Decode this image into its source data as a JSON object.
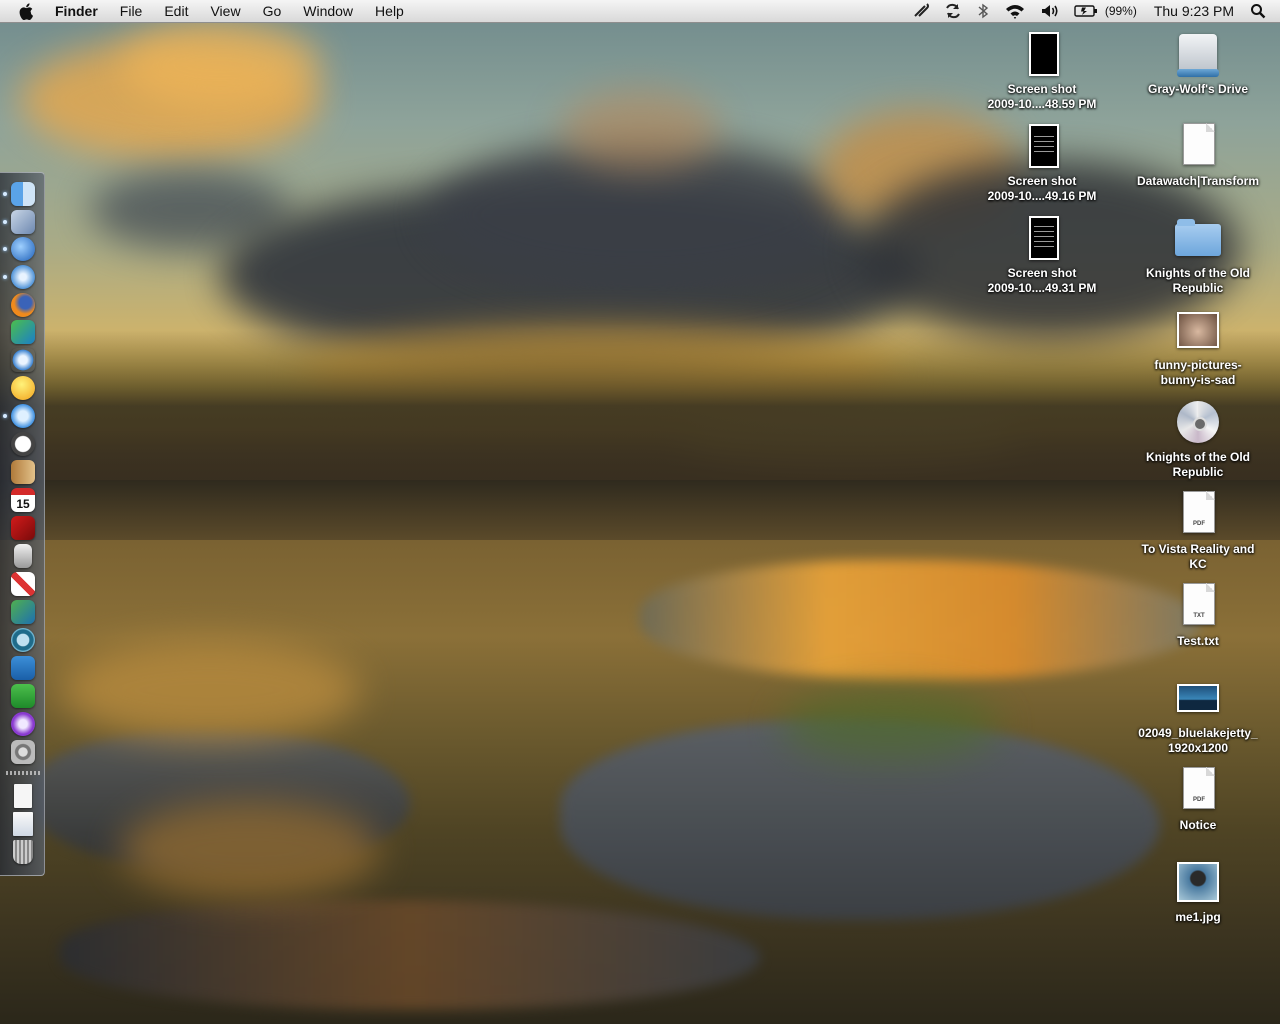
{
  "menubar": {
    "app_name": "Finder",
    "menus": [
      "File",
      "Edit",
      "View",
      "Go",
      "Window",
      "Help"
    ],
    "status": {
      "battery": "(99%)",
      "clock": "Thu 9:23 PM",
      "icons": [
        "script-icon",
        "sync-icon",
        "bluetooth-icon",
        "wifi-icon",
        "volume-icon",
        "battery-icon",
        "spotlight-icon"
      ]
    }
  },
  "dock": {
    "items": [
      {
        "name": "finder",
        "running": true
      },
      {
        "name": "mail",
        "running": true
      },
      {
        "name": "internet-explorer",
        "running": true
      },
      {
        "name": "safari",
        "running": true
      },
      {
        "name": "firefox",
        "running": false
      },
      {
        "name": "messenger",
        "running": false
      },
      {
        "name": "network",
        "running": false
      },
      {
        "name": "adium",
        "running": false
      },
      {
        "name": "itunes",
        "running": true
      },
      {
        "name": "clock",
        "running": false
      },
      {
        "name": "address-book",
        "running": false
      },
      {
        "name": "ical",
        "running": false,
        "text": "15"
      },
      {
        "name": "photo-booth",
        "running": false
      },
      {
        "name": "usb-drive",
        "running": false
      },
      {
        "name": "solitaire",
        "running": false
      },
      {
        "name": "preview",
        "running": false
      },
      {
        "name": "time-machine",
        "running": false
      },
      {
        "name": "word",
        "running": false
      },
      {
        "name": "excel",
        "running": false
      },
      {
        "name": "ie-blue",
        "running": false
      },
      {
        "name": "system-preferences",
        "running": false
      },
      {
        "name": "documents-stack",
        "running": false
      },
      {
        "name": "downloads-stack",
        "running": false
      },
      {
        "name": "trash",
        "running": false
      }
    ]
  },
  "desktop": {
    "icons": [
      {
        "type": "screenshot",
        "line1": "Screen shot",
        "line2": "2009-10....48.59 PM"
      },
      {
        "type": "screenshot",
        "line1": "Screen shot",
        "line2": "2009-10....49.16 PM"
      },
      {
        "type": "screenshot",
        "line1": "Screen shot",
        "line2": "2009-10....49.31 PM"
      },
      {
        "type": "drive",
        "line1": "Gray-Wolf's Drive",
        "line2": ""
      },
      {
        "type": "document",
        "line1": "Datawatch|Transform",
        "line2": ""
      },
      {
        "type": "folder",
        "line1": "Knights of the Old",
        "line2": "Republic"
      },
      {
        "type": "photo",
        "line1": "funny-pictures-",
        "line2": "bunny-is-sad"
      },
      {
        "type": "dvd",
        "line1": "Knights of the Old",
        "line2": "Republic"
      },
      {
        "type": "pdf",
        "tag": "PDF",
        "line1": "To Vista Reality and",
        "line2": "KC"
      },
      {
        "type": "txt",
        "tag": "TXT",
        "line1": "Test.txt",
        "line2": ""
      },
      {
        "type": "photo",
        "line1": "02049_bluelakejetty_",
        "line2": "1920x1200"
      },
      {
        "type": "pdf",
        "tag": "PDF",
        "line1": "Notice",
        "line2": ""
      },
      {
        "type": "photo",
        "line1": "me1.jpg",
        "line2": ""
      }
    ]
  }
}
